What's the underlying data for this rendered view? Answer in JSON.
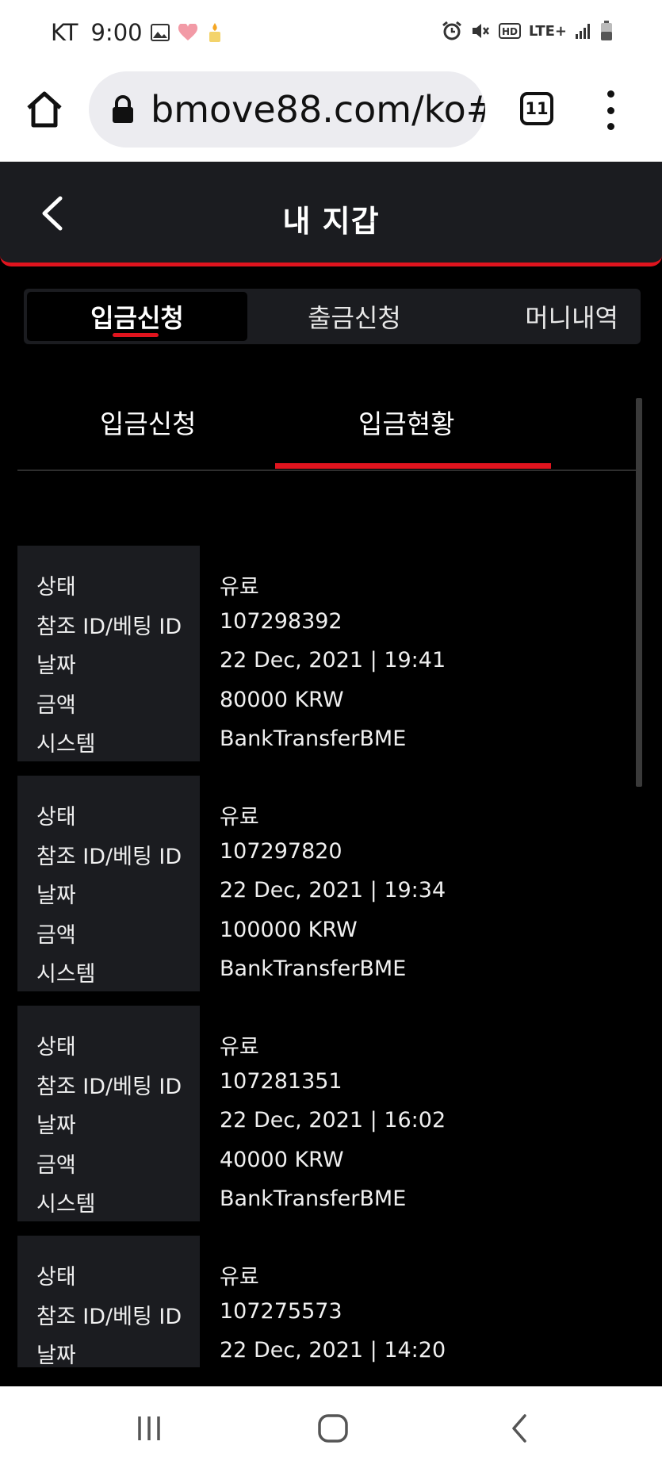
{
  "status_bar": {
    "carrier": "KT",
    "time": "9:00",
    "network": "LTE+",
    "icons": [
      "gallery-icon",
      "heart-icon",
      "candle-icon",
      "alarm-icon",
      "mute-icon",
      "hd-icon",
      "signal-icon",
      "battery-icon"
    ]
  },
  "browser": {
    "url": "bmove88.com/ko#",
    "tab_count": "11"
  },
  "header": {
    "title": "내 지갑"
  },
  "main_tabs": [
    {
      "label": "입금신청",
      "active": true
    },
    {
      "label": "출금신청",
      "active": false
    },
    {
      "label": "머니내역",
      "active": false
    }
  ],
  "sub_tabs": [
    {
      "label": "입금신청",
      "active": false
    },
    {
      "label": "입금현황",
      "active": true
    }
  ],
  "record_labels": {
    "status": "상태",
    "ref": "참조 ID/베팅 ID",
    "date": "날짜",
    "amount": "금액",
    "system": "시스템"
  },
  "records": [
    {
      "status": "유료",
      "ref": "107298392",
      "date": "22 Dec, 2021 | 19:41",
      "amount": "80000 KRW",
      "system": "BankTransferBME"
    },
    {
      "status": "유료",
      "ref": "107297820",
      "date": "22 Dec, 2021 | 19:34",
      "amount": "100000 KRW",
      "system": "BankTransferBME"
    },
    {
      "status": "유료",
      "ref": "107281351",
      "date": "22 Dec, 2021 | 16:02",
      "amount": "40000 KRW",
      "system": "BankTransferBME"
    },
    {
      "status": "유료",
      "ref": "107275573",
      "date": "22 Dec, 2021 | 14:20",
      "amount": "",
      "system": ""
    }
  ],
  "colors": {
    "accent": "#e0141e",
    "panel": "#1b1c20",
    "background": "#000000"
  }
}
